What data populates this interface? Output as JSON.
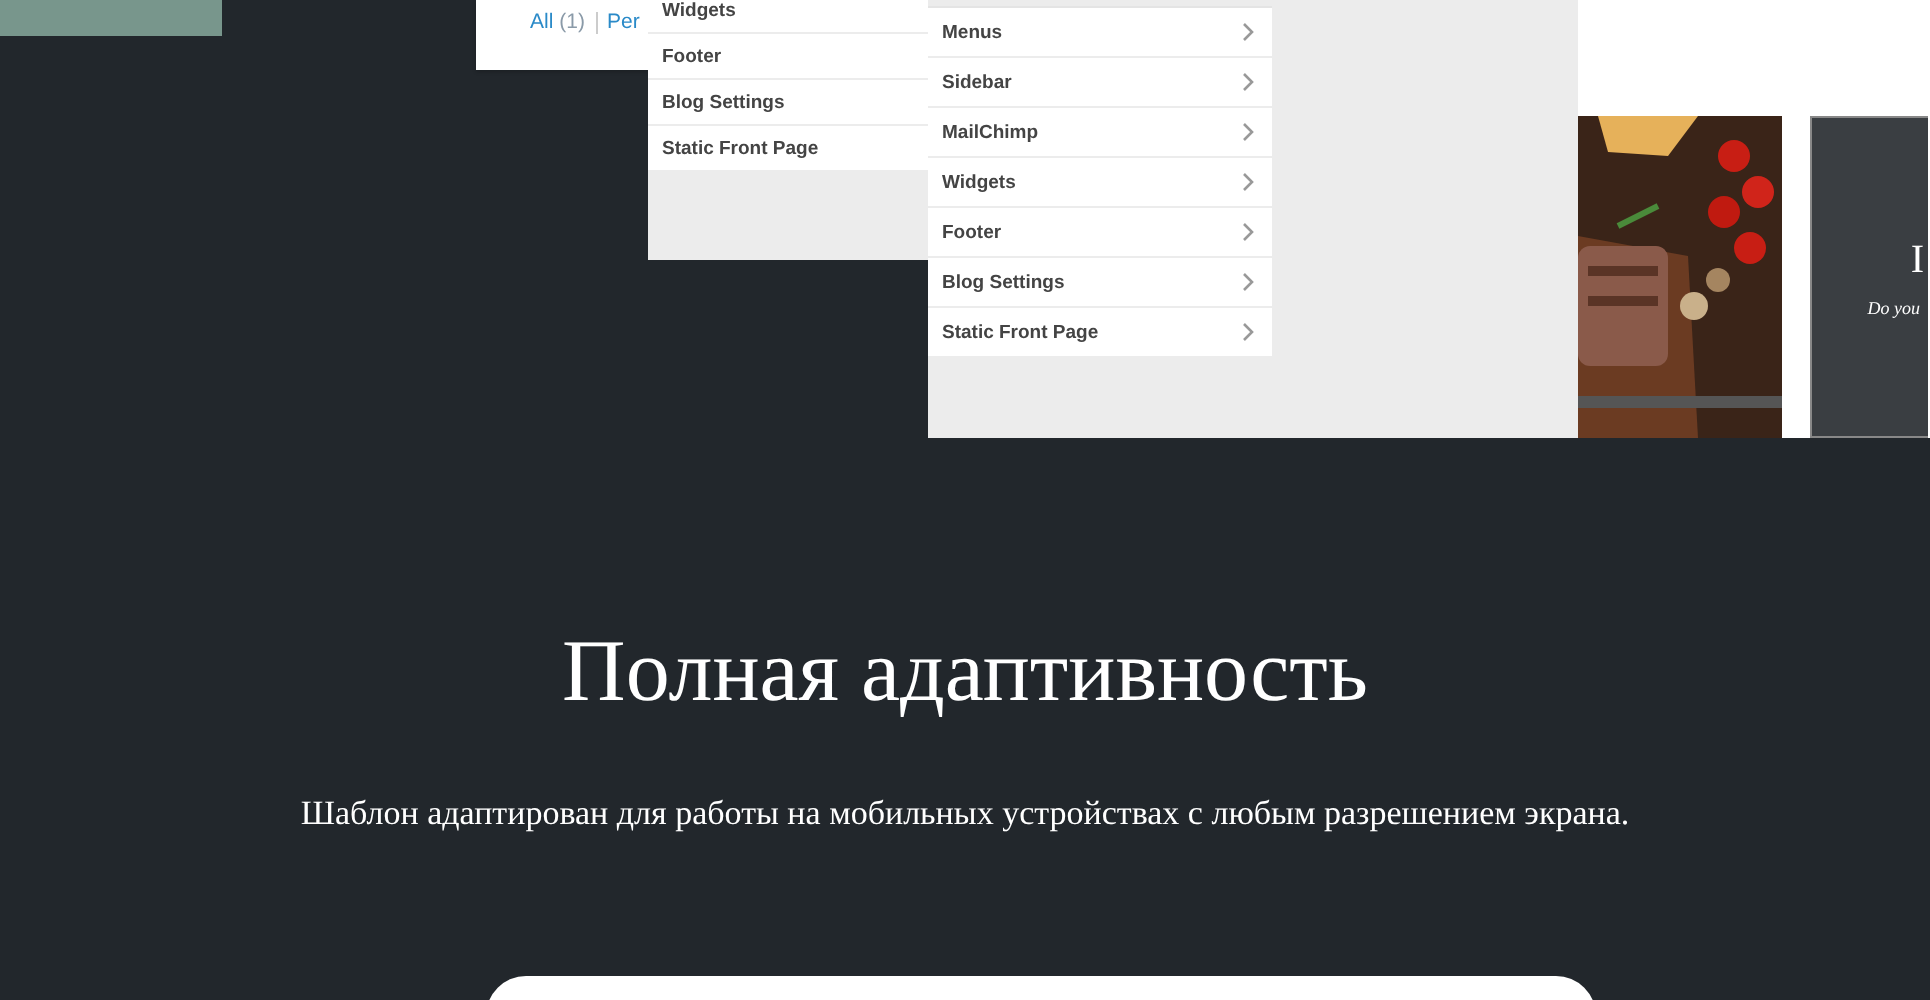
{
  "posts_panel": {
    "filters": [
      {
        "label": "All",
        "count": "(1)"
      },
      {
        "label": "Per"
      }
    ]
  },
  "menu_panel": {
    "items": [
      "Widgets",
      "Footer",
      "Blog Settings",
      "Static Front Page"
    ]
  },
  "customizer_panel": {
    "items": [
      "Menus",
      "Sidebar",
      "MailChimp",
      "Widgets",
      "Footer",
      "Blog Settings",
      "Static Front Page"
    ]
  },
  "thumbnails": [
    {
      "kind": "picture"
    },
    {
      "kind": "dark",
      "title": "I",
      "subtitle": "Do you"
    }
  ],
  "heading": "Полная адаптивность",
  "text": "Шаблон адаптирован для работы на мобильных устройствах с любым разрешением экрана."
}
